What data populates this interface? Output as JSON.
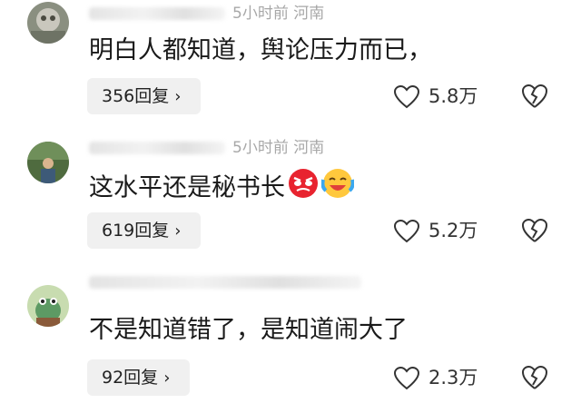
{
  "comments": [
    {
      "meta": "5小时前  河南",
      "text": "明白人都知道，舆论压力而已，",
      "reply_count": "356回复",
      "likes": "5.8万",
      "avatar_icon": "cat-photo-avatar"
    },
    {
      "meta": "5小时前  河南",
      "text": "这水平还是秘书长",
      "emojis": [
        "angry-face-emoji",
        "laughing-crying-emoji"
      ],
      "reply_count": "619回复",
      "likes": "5.2万",
      "avatar_icon": "person-photo-avatar"
    },
    {
      "meta": "",
      "text": "不是知道错了，是知道闹大了",
      "reply_count": "92回复",
      "likes": "2.3万",
      "avatar_icon": "cartoon-avatar"
    }
  ],
  "icons": {
    "reply_chevron": "chevron-right-icon",
    "like": "heart-icon",
    "dislike": "broken-heart-icon"
  }
}
